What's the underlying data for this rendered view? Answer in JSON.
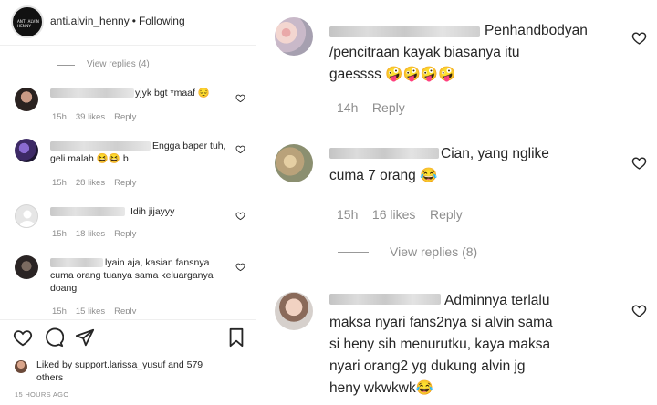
{
  "post": {
    "username": "anti.alvin_henny",
    "separator": "•",
    "follow_status": "Following",
    "avatar_text": "ANTI ALVIN HENNY"
  },
  "left_comments": {
    "view_replies": "View replies (4)",
    "items": [
      {
        "text": "yjyk bgt *maaf 😔",
        "time": "15h",
        "likes": "39 likes",
        "reply": "Reply"
      },
      {
        "text": "Engga baper tuh, geli malah 😆😆 b",
        "time": "15h",
        "likes": "28 likes",
        "reply": "Reply"
      },
      {
        "text": "Idih jijayyy",
        "time": "15h",
        "likes": "18 likes",
        "reply": "Reply"
      },
      {
        "text": "lyain aja, kasian fansnya cuma orang tuanya sama keluarganya doang",
        "time": "15h",
        "likes": "15 likes",
        "reply": "Reply"
      }
    ]
  },
  "footer": {
    "liked_by_prefix": "Liked by",
    "liked_by_user": "support.larissa_yusuf",
    "liked_by_suffix": "and",
    "others": "579 others",
    "timestamp": "15 HOURS AGO"
  },
  "right_comments": {
    "items": [
      {
        "text_line1": "Penhandbodyan",
        "text_line2": "/pencitraan kayak biasanya itu",
        "text_line3": "gaessss 🤪🤪🤪🤪",
        "time": "14h",
        "likes": "",
        "reply": "Reply"
      },
      {
        "text_line1": "Cian, yang nglike",
        "text_line2": "cuma 7 orang 😂",
        "time": "15h",
        "likes": "16 likes",
        "reply": "Reply"
      },
      {
        "text_line1": "Adminnya terlalu",
        "text_line2": "maksa nyari fans2nya si alvin sama",
        "text_line3": "si heny sih menurutku, kaya maksa",
        "text_line4": "nyari orang2 yg dukung alvin jg",
        "text_line5": "heny wkwkwk😂"
      }
    ],
    "view_replies": "View replies (8)"
  },
  "colors": {
    "text": "#262626",
    "muted": "#8e8e8e",
    "border": "#dbdbdb"
  }
}
